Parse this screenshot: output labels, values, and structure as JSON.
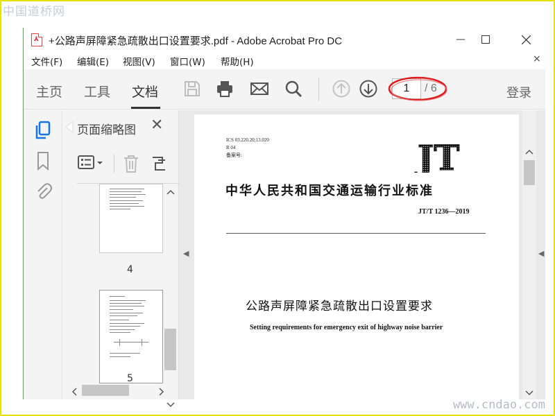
{
  "watermarks": {
    "top": "中国道桥网",
    "bottom": "www.cndao.com"
  },
  "window": {
    "title": "+公路声屏障紧急疏散出口设置要求.pdf - Adobe Acrobat Pro DC",
    "file_icon": "pdf-file-icon",
    "controls": {
      "minimize": "—",
      "maximize": "☐",
      "close": "✕"
    }
  },
  "menubar": {
    "items": [
      "文件(F)",
      "编辑(E)",
      "视图(V)",
      "窗口(W)",
      "帮助(H)"
    ],
    "close_glyph": "×"
  },
  "toolbar": {
    "tabs": [
      "主页",
      "工具",
      "文档"
    ],
    "active_tab": "文档",
    "icons": [
      "save-icon",
      "print-icon",
      "email-icon",
      "search-icon",
      "previous-page-icon",
      "next-page-icon"
    ],
    "page_current": "1",
    "page_total": "/ 6",
    "login_label": "登录",
    "highlight_color": "#e01b1b"
  },
  "left_rail": {
    "icons": [
      "page-thumbnails-icon",
      "bookmark-icon",
      "attachment-icon"
    ],
    "accent": "#1473e6"
  },
  "thumbnail_pane": {
    "title": "页面缩略图",
    "close_glyph": "✕",
    "tools": [
      "thumbnail-options-icon",
      "delete-icon",
      "extract-icon"
    ],
    "pages": [
      {
        "number": "4"
      },
      {
        "number": "5"
      }
    ]
  },
  "document": {
    "meta": [
      "ICS 03.220.20;13.020",
      "R 04",
      "备案号:"
    ],
    "logo_text": "JT",
    "heading": "中华人民共和国交通运输行业标准",
    "code": "JT/T 1236—2019",
    "title": "公路声屏障紧急疏散出口设置要求",
    "subtitle": "Setting requirements for emergency exit of highway noise barrier"
  }
}
